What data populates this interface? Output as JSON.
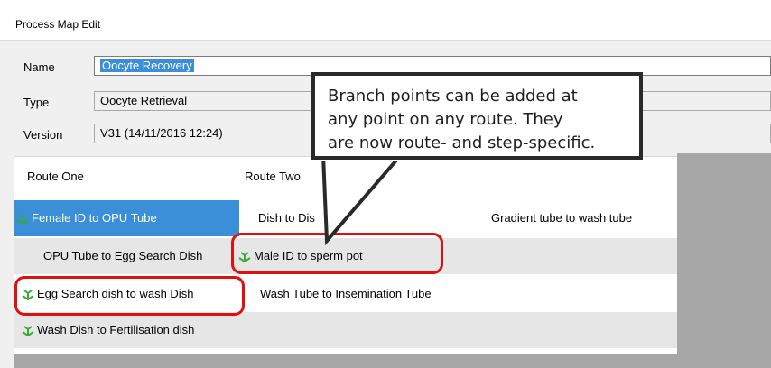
{
  "window": {
    "title": "Process Map Edit"
  },
  "form": {
    "name_label": "Name",
    "name_value": "Oocyte Recovery",
    "type_label": "Type",
    "type_value": "Oocyte Retrieval",
    "version_label": "Version",
    "version_value": "V31 (14/11/2016 12:24)"
  },
  "grid": {
    "columns": [
      "Route One",
      "Route Two"
    ],
    "rows": [
      {
        "route_one": "Female ID to OPU Tube",
        "route_two": "Dish to Dis",
        "route_three": "Gradient tube to wash tube"
      },
      {
        "route_one": "OPU Tube to Egg Search Dish",
        "route_two": "Male ID to sperm pot",
        "route_three": ""
      },
      {
        "route_one": "Egg Search dish to wash Dish",
        "route_two": "Wash Tube to Insemination Tube",
        "route_three": ""
      },
      {
        "route_one": "Wash Dish to Fertilisation dish",
        "route_two": "",
        "route_three": ""
      }
    ]
  },
  "callout": {
    "lines": [
      "Branch points can be added at",
      "any point on any route. They",
      "are now route- and step-specific."
    ]
  },
  "icons": {
    "branch": "branch-point-icon"
  },
  "colors": {
    "selection": "#3b8fd9",
    "highlight": "#e01010",
    "branch_icon": "#3aa93a"
  }
}
